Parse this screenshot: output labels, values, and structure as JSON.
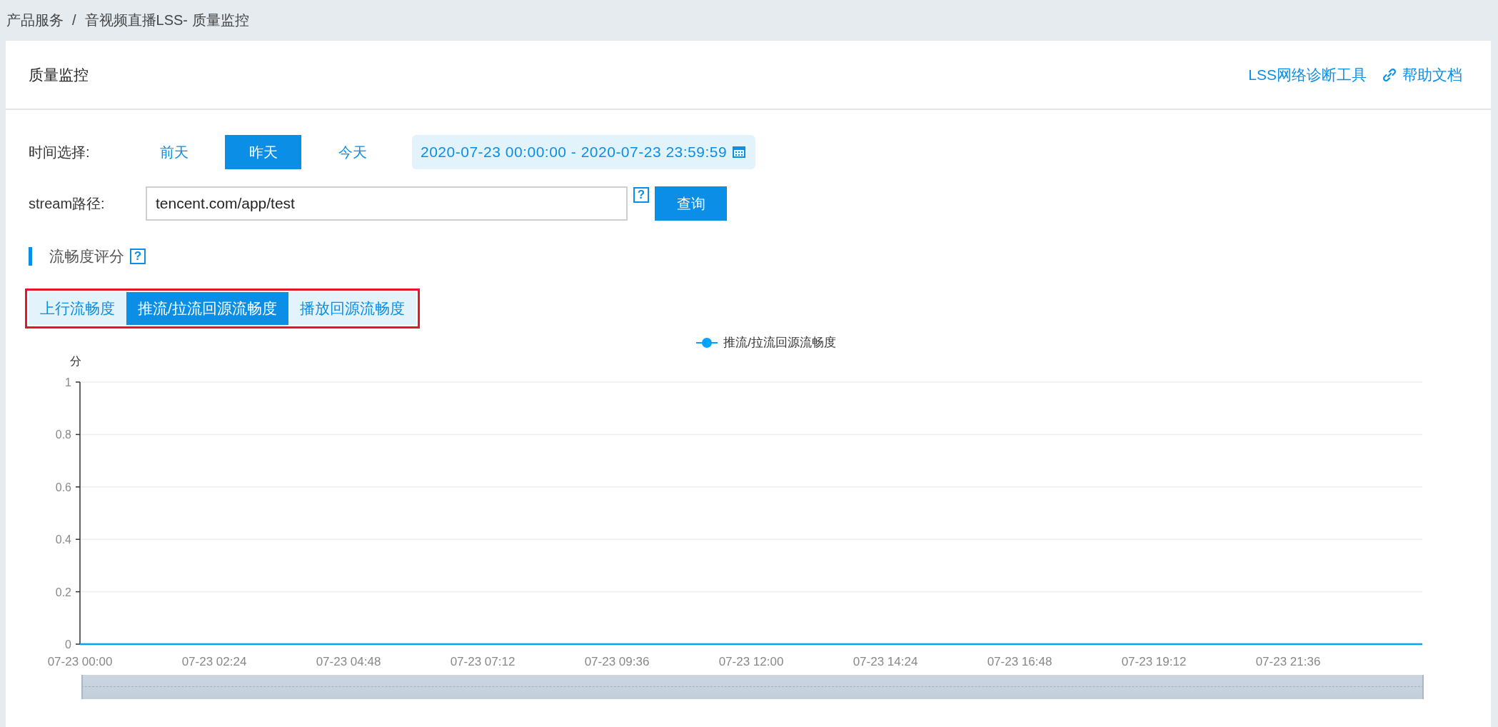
{
  "breadcrumb": [
    "产品服务",
    "/",
    "音视频直播LSS- 质量监控"
  ],
  "header": {
    "title": "质量监控",
    "links": [
      {
        "kind": "plain",
        "label": "LSS网络诊断工具"
      },
      {
        "kind": "icon",
        "label": "帮助文档"
      }
    ]
  },
  "time_select": {
    "label": "时间选择:",
    "options": [
      {
        "label": "前天",
        "selected": false
      },
      {
        "label": "昨天",
        "selected": true
      },
      {
        "label": "今天",
        "selected": false
      }
    ],
    "range": "2020-07-23 00:00:00 - 2020-07-23 23:59:59"
  },
  "stream": {
    "label": "stream路径:",
    "value": "tencent.com/app/test",
    "help": "?",
    "button": "查询"
  },
  "section": {
    "title": "流畅度评分",
    "help": "?"
  },
  "tabs": [
    {
      "label": "上行流畅度",
      "selected": false
    },
    {
      "label": "推流/拉流回源流畅度",
      "selected": true
    },
    {
      "label": "播放回源流畅度",
      "selected": false
    }
  ],
  "chart_data": {
    "type": "line",
    "grid": true,
    "ylabel": "分",
    "categories": [
      "07-23 00:00",
      "07-23 02:24",
      "07-23 04:48",
      "07-23 07:12",
      "07-23 09:36",
      "07-23 12:00",
      "07-23 14:24",
      "07-23 16:48",
      "07-23 19:12",
      "07-23 21:36",
      null
    ],
    "ylim": [
      0,
      1
    ],
    "yticks": [
      {
        "value": 0,
        "label": "0"
      },
      {
        "value": 0.2,
        "label": "0.2"
      },
      {
        "value": 0.4,
        "label": "0.4"
      },
      {
        "value": 0.6,
        "label": "0.6"
      },
      {
        "value": 0.8,
        "label": "0.8"
      },
      {
        "value": 1,
        "label": "1"
      }
    ],
    "series": [
      {
        "name": "推流/拉流回源流畅度",
        "color": "#00a4ff",
        "values": [
          0,
          0,
          0,
          0,
          0,
          0,
          0,
          0,
          0,
          0,
          0
        ]
      }
    ]
  },
  "zoom_slider": {
    "level": 1
  }
}
